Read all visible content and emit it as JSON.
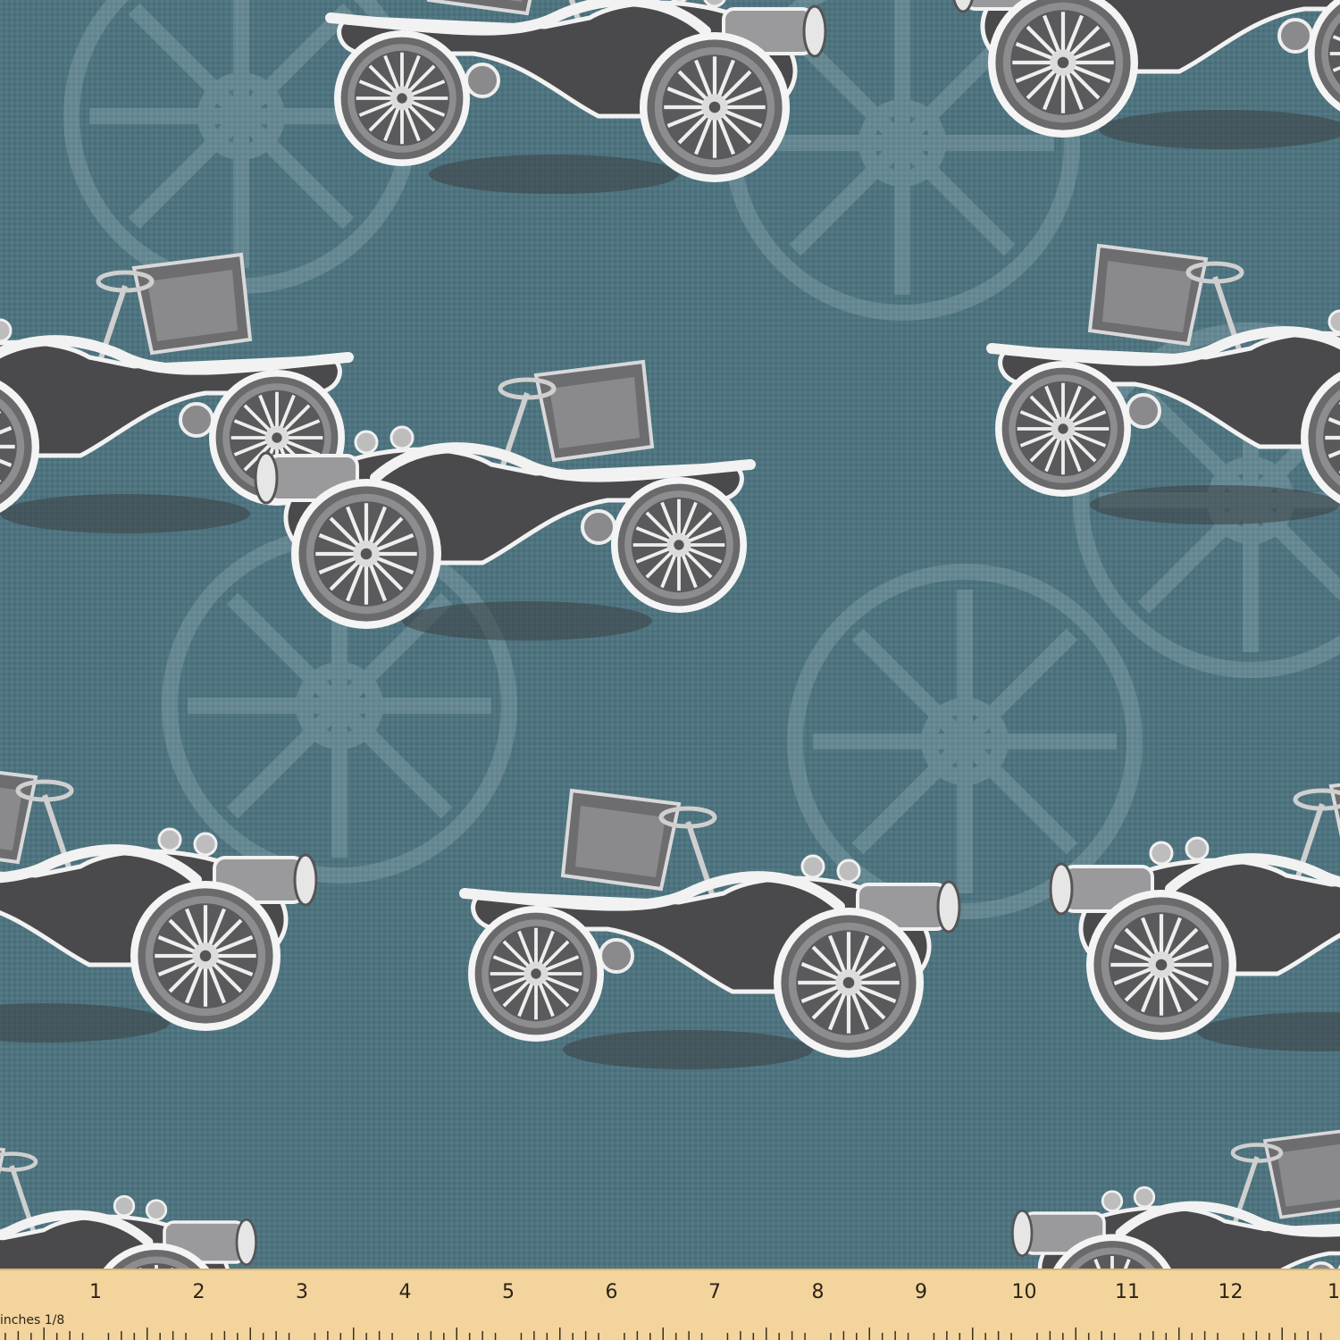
{
  "image": {
    "subject": "vintage-car-pattern-fabric",
    "background_color": "#4f7480",
    "car_body_color": "#4a4a4c",
    "car_trim_color": "#f2f2f2",
    "car_accent_color": "#8a8a8c"
  },
  "ruler": {
    "unit_label": "inches 1/8",
    "numbers": [
      "1",
      "2",
      "3",
      "4",
      "5",
      "6",
      "7",
      "8",
      "9",
      "10",
      "11",
      "12",
      "1"
    ]
  }
}
